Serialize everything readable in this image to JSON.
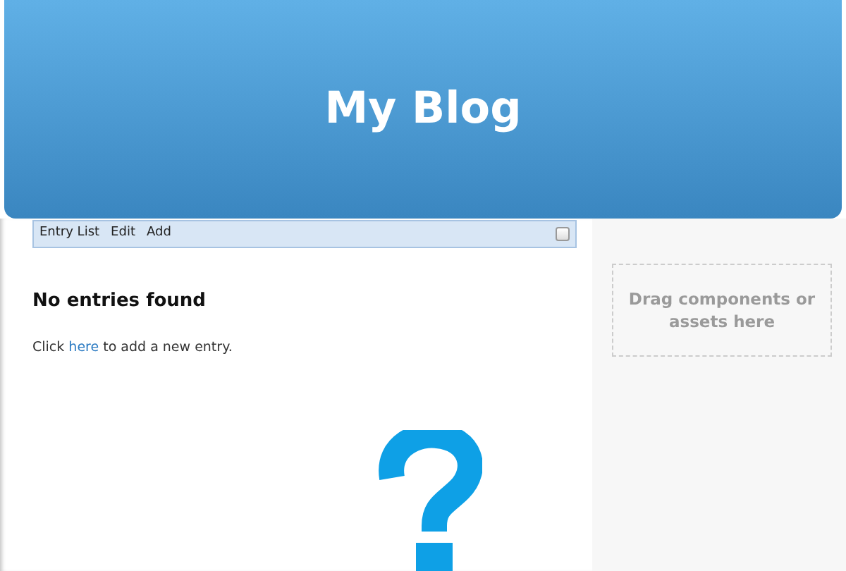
{
  "header": {
    "title": "My Blog"
  },
  "toolbar": {
    "items": [
      "Entry List",
      "Edit",
      "Add"
    ],
    "checkbox": {
      "checked": false
    }
  },
  "content": {
    "heading": "No entries found",
    "message": {
      "before": "Click ",
      "link": "here",
      "after": " to add a new entry."
    }
  },
  "sidebar": {
    "drop_zone": "Drag components or assets here"
  }
}
